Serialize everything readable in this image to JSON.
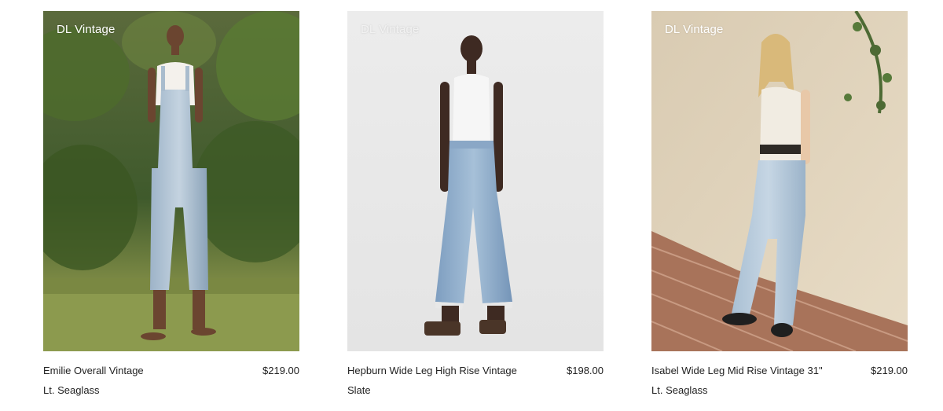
{
  "products": [
    {
      "badge": "DL Vintage",
      "name": "Emilie Overall Vintage",
      "price": "$219.00",
      "color": "Lt. Seaglass"
    },
    {
      "badge": "DL Vintage",
      "name": "Hepburn Wide Leg High Rise Vintage",
      "price": "$198.00",
      "color": "Slate"
    },
    {
      "badge": "DL Vintage",
      "name": "Isabel Wide Leg Mid Rise Vintage 31\"",
      "price": "$219.00",
      "color": "Lt. Seaglass"
    }
  ]
}
